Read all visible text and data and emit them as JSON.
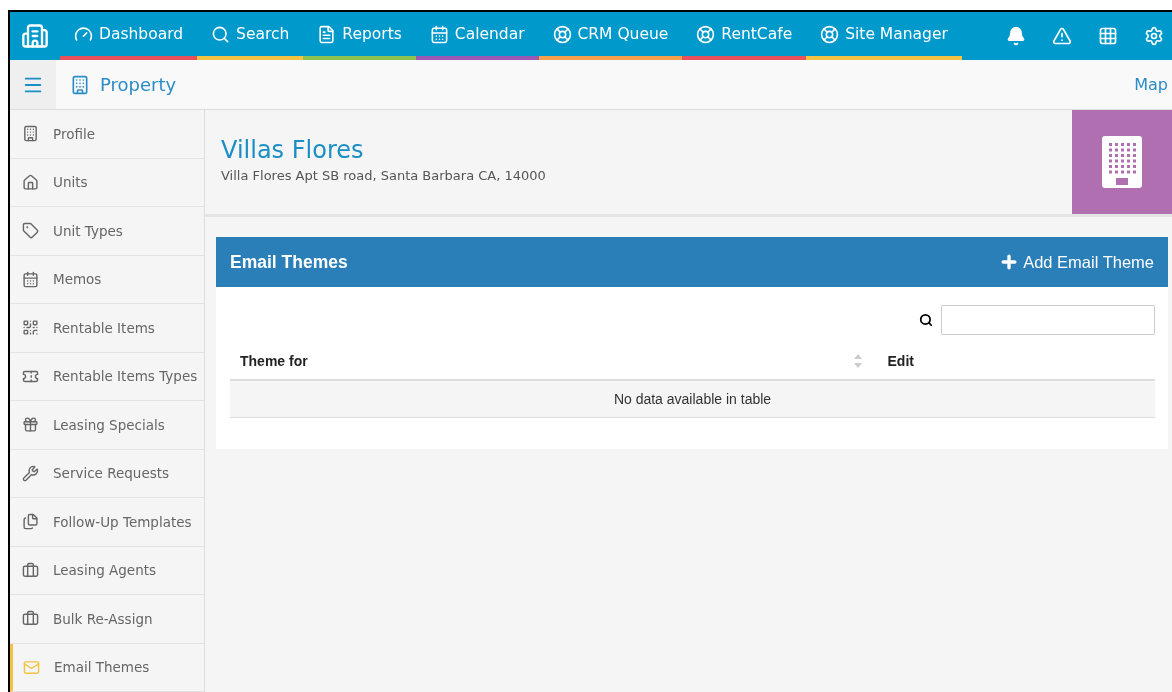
{
  "top_nav": {
    "items": [
      {
        "label": "Dashboard",
        "color": "#e8505b"
      },
      {
        "label": "Search",
        "color": "#f5c342"
      },
      {
        "label": "Reports",
        "color": "#8cc152"
      },
      {
        "label": "Calendar",
        "color": "#9b59b6"
      },
      {
        "label": "CRM Queue",
        "color": "#f5a14a"
      },
      {
        "label": "RentCafe",
        "color": "#e8505b"
      },
      {
        "label": "Site Manager",
        "color": "#f5c342"
      }
    ]
  },
  "sub_bar": {
    "title": "Property",
    "link": "Map"
  },
  "sidebar": {
    "items": [
      {
        "label": "Profile",
        "selected": false
      },
      {
        "label": "Units",
        "selected": false
      },
      {
        "label": "Unit Types",
        "selected": false
      },
      {
        "label": "Memos",
        "selected": false
      },
      {
        "label": "Rentable Items",
        "selected": false
      },
      {
        "label": "Rentable Items Types",
        "selected": false
      },
      {
        "label": "Leasing Specials",
        "selected": false
      },
      {
        "label": "Service Requests",
        "selected": false
      },
      {
        "label": "Follow-Up Templates",
        "selected": false
      },
      {
        "label": "Leasing Agents",
        "selected": false
      },
      {
        "label": "Bulk Re-Assign",
        "selected": false
      },
      {
        "label": "Email Themes",
        "selected": true
      }
    ]
  },
  "property": {
    "name": "Villas Flores",
    "address": "Villa Flores Apt SB road, Santa Barbara CA, 14000"
  },
  "panel": {
    "title": "Email Themes",
    "add_button": "Add Email Theme",
    "table": {
      "columns": [
        "Theme for",
        "Edit"
      ],
      "empty_message": "No data available in table"
    }
  }
}
